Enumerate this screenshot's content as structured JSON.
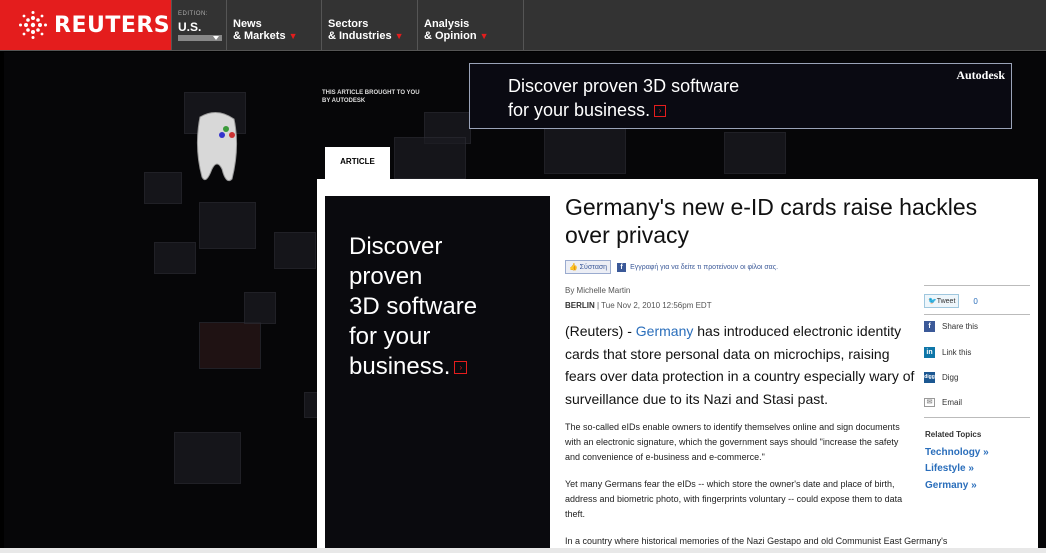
{
  "nav": {
    "brand": "REUTERS",
    "edition_label": "EDITION:",
    "edition_value": "U.S.",
    "items": [
      {
        "label": "News\n& Markets",
        "arrow": "▼"
      },
      {
        "label": "Sectors\n& Industries",
        "arrow": "▼"
      },
      {
        "label": "Analysis\n& Opinion",
        "arrow": "▼"
      }
    ]
  },
  "ad": {
    "brought": "THIS ARTICLE BROUGHT TO YOU\nBY AUTODESK",
    "top_text": "Discover proven 3D software\nfor your business.",
    "brand": "Autodesk",
    "left_text": "Discover\nproven\n3D software\nfor your\nbusiness."
  },
  "tab": {
    "label": "ARTICLE"
  },
  "article": {
    "title": "Germany's new e-ID cards raise hackles over privacy",
    "like_label": "Σύσταση",
    "fb_text": "Εγγραφή για να δείτε τι προτείνουν οι φίλοι σας.",
    "byline": "By Michelle Martin",
    "dateline_city": "BERLIN",
    "dateline_date": " | Tue Nov 2, 2010 12:56pm EDT",
    "lead_pre": "(Reuters) - ",
    "lead_link": "Germany",
    "lead_post": " has introduced electronic identity cards that store personal data on microchips, raising fears over data protection in a country especially wary of surveillance due to its Nazi and Stasi past.",
    "p1": "The so-called eIDs enable owners to identify themselves online and sign documents with an electronic signature, which the government says should \"increase the safety and convenience of e-business and e-commerce.\"",
    "p2": "Yet many Germans fear the eIDs -- which store the owner's date and place of birth, address and biometric photo, with fingerprints voluntary -- could expose them to data theft.",
    "p3": "In a country where historical memories of the Nazi Gestapo and old Communist East Germany's"
  },
  "share": {
    "tweet": "Tweet",
    "tweet_count": "0",
    "items": [
      "Share this",
      "Link this",
      "Digg",
      "Email"
    ]
  },
  "related": {
    "title": "Related Topics",
    "items": [
      "Technology »",
      "Lifestyle »",
      "Germany »"
    ]
  },
  "colors": {
    "brand_red": "#e41d1d",
    "link_blue": "#2a6ebb",
    "facebook": "#3b5998"
  }
}
